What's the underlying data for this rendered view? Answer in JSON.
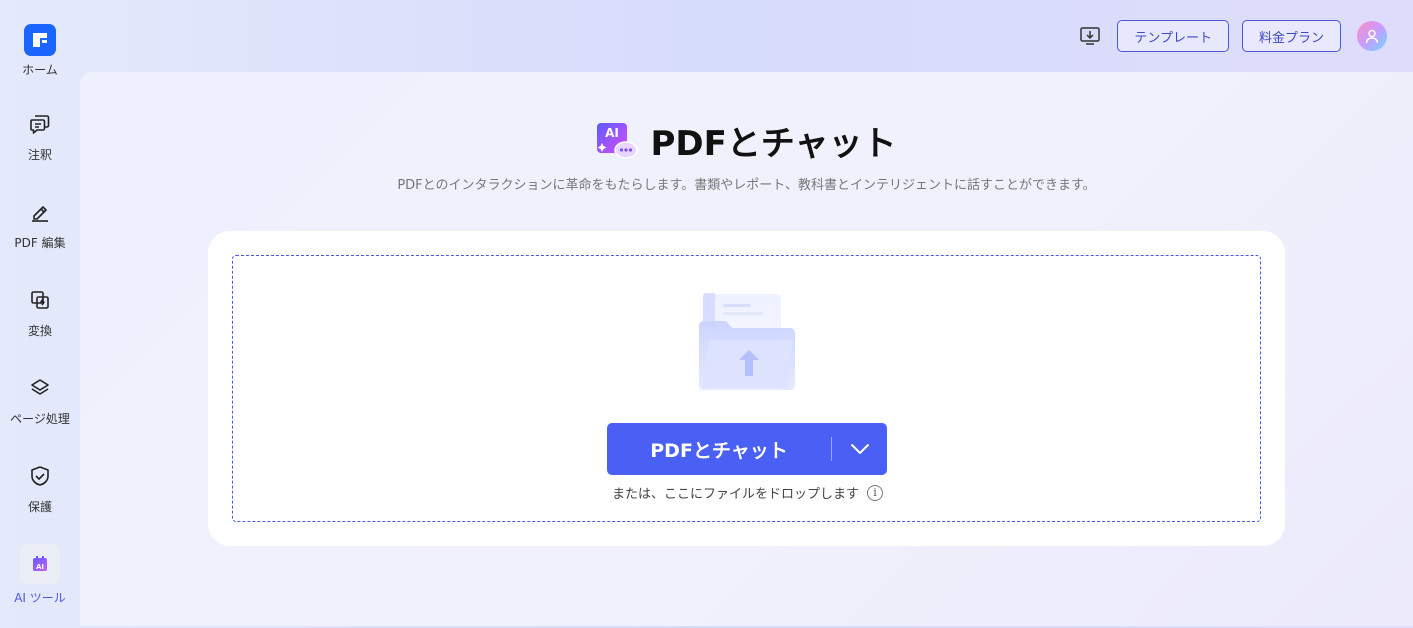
{
  "sidebar": {
    "items": [
      {
        "label": "ホーム",
        "icon": "app-logo-icon"
      },
      {
        "label": "注釈",
        "icon": "comment-icon"
      },
      {
        "label": "PDF 編集",
        "icon": "edit-pen-icon"
      },
      {
        "label": "変換",
        "icon": "convert-icon"
      },
      {
        "label": "ページ処理",
        "icon": "layers-icon"
      },
      {
        "label": "保護",
        "icon": "shield-check-icon"
      },
      {
        "label": "AI ツール",
        "icon": "ai-tool-icon",
        "active": true
      }
    ]
  },
  "topbar": {
    "download_icon": "download-monitor-icon",
    "template_label": "テンプレート",
    "pricing_label": "料金プラン",
    "avatar_icon": "user-avatar-icon"
  },
  "main": {
    "title": "PDFとチャット",
    "subtitle": "PDFとのインタラクションに革命をもたらします。書類やレポート、教科書とインテリジェントに話すことができます。",
    "upload_button_label": "PDFとチャット",
    "drop_hint": "または、ここにファイルをドロップします",
    "info_glyph": "i"
  },
  "colors": {
    "accent": "#4a60f5",
    "sidebar_active": "#4a57e8",
    "brand_logo": "#1a66ff"
  }
}
